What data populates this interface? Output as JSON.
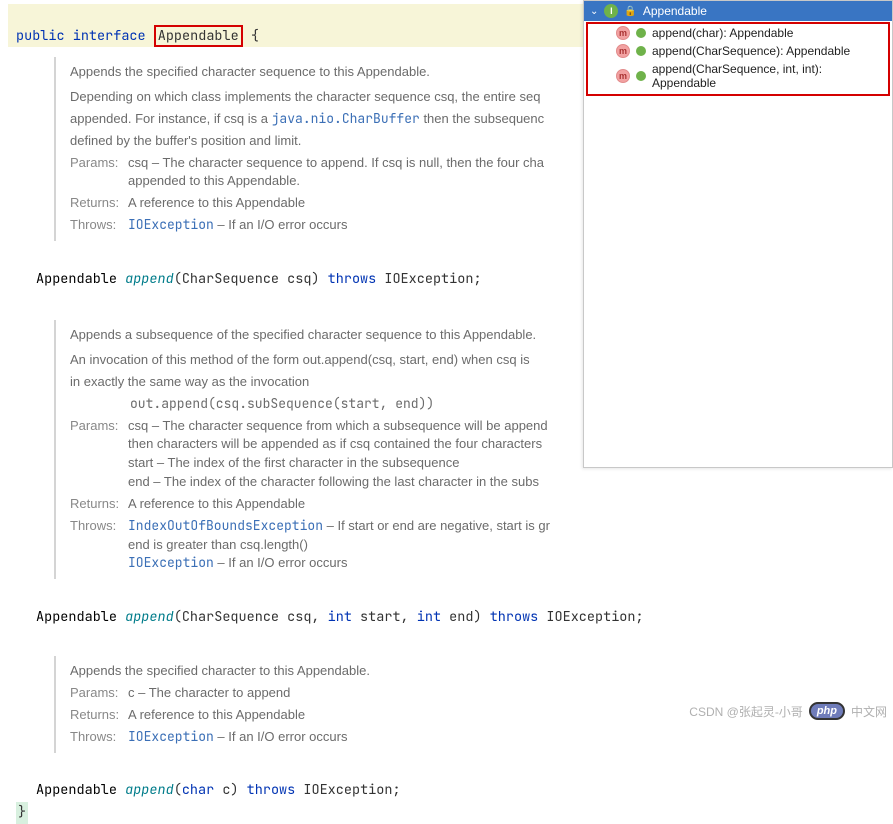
{
  "code": {
    "decl_public": "public",
    "decl_interface": "interface",
    "decl_name": "Appendable",
    "brace_open": "{",
    "sig1_ret": "Appendable",
    "sig1_name": "append",
    "sig1_params": "(CharSequence csq)",
    "sig1_throws": "throws",
    "sig1_exc": "IOException;",
    "sig2_ret": "Appendable",
    "sig2_name": "append",
    "sig2_params": "(CharSequence csq,",
    "sig2_int": "int",
    "sig2_start": " start,",
    "sig2_end": " end)",
    "sig2_throws": "throws",
    "sig2_exc": "IOException;",
    "sig3_ret": "Appendable",
    "sig3_name": "append",
    "sig3_paren_open": "(",
    "sig3_char": "char",
    "sig3_c": " c)",
    "sig3_throws": "throws",
    "sig3_exc": "IOException;",
    "brace_close": "}"
  },
  "doc1": {
    "summary": "Appends the specified character sequence to this Appendable.",
    "detail_a": "Depending on which class implements the character sequence csq, the entire seq",
    "detail_b1": "appended. For instance, if csq is a ",
    "detail_b_link": "java.nio.CharBuffer",
    "detail_b2": " then the subsequenc",
    "detail_c": "defined by the buffer's position and limit.",
    "params_label": "Params:",
    "params_text1": "csq – The character sequence to append. If csq is null, then the four cha",
    "params_text2": "appended to this Appendable.",
    "returns_label": "Returns:",
    "returns_text": "A reference to this Appendable",
    "throws_label": "Throws:",
    "throws_link": "IOException",
    "throws_text": " – If an I/O error occurs"
  },
  "doc2": {
    "summary": "Appends a subsequence of the specified character sequence to this Appendable.",
    "detail_a": "An invocation of this method of the form out.append(csq, start, end) when csq is",
    "detail_b": "in exactly the same way as the invocation",
    "detail_code": "     out.append(csq.subSequence(start, end))",
    "params_label": "Params:",
    "params_csq1": "csq – The character sequence from which a subsequence will be append",
    "params_csq2": "then characters will be appended as if csq contained the four characters",
    "params_start": "start – The index of the first character in the subsequence",
    "params_end": "end – The index of the character following the last character in the subs",
    "returns_label": "Returns:",
    "returns_text": "A reference to this Appendable",
    "throws_label": "Throws:",
    "throws_link1": "IndexOutOfBoundsException",
    "throws_text1": " – If start or end are negative, start is gr",
    "throws_text1b": "end is greater than csq.length()",
    "throws_link2": "IOException",
    "throws_text2": " – If an I/O error occurs"
  },
  "doc3": {
    "summary": "Appends the specified character to this Appendable.",
    "params_label": "Params:",
    "params_text": "c – The character to append",
    "returns_label": "Returns:",
    "returns_text": "A reference to this Appendable",
    "throws_label": "Throws:",
    "throws_link": "IOException",
    "throws_text": " – If an I/O error occurs"
  },
  "structure": {
    "root": "Appendable",
    "items": [
      "append(char): Appendable",
      "append(CharSequence): Appendable",
      "append(CharSequence, int, int): Appendable"
    ]
  },
  "watermark": {
    "text": "CSDN @张起灵-小哥",
    "badge": "php",
    "site": "中文网"
  }
}
